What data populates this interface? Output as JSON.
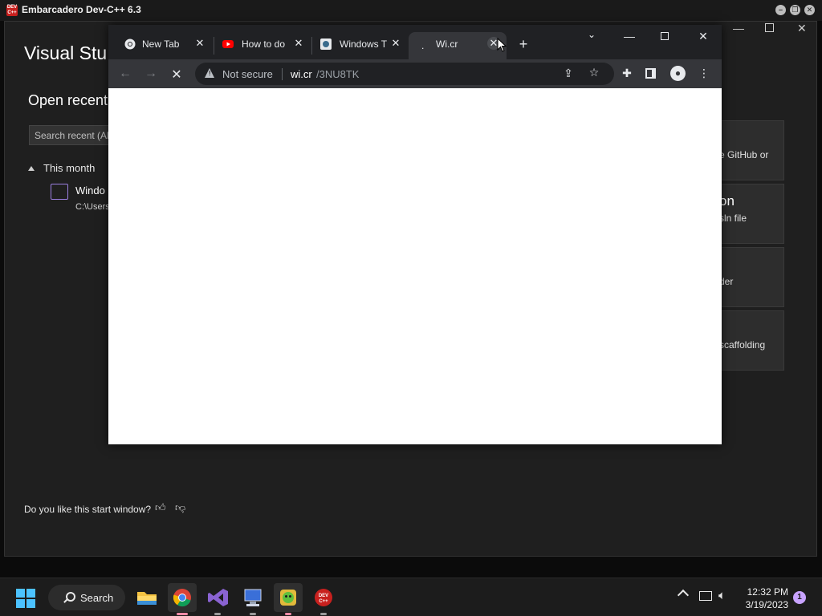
{
  "devcpp": {
    "title": "Embarcadero Dev-C++ 6.3",
    "logo_text": "DEV C++"
  },
  "vs": {
    "title": "Visual Stu",
    "open_recent": "Open recent",
    "search_placeholder": "Search recent (Alt",
    "group_label": "This month",
    "recent_item_name": "Windo",
    "recent_item_path": "C:\\Users",
    "cards": [
      {
        "line1": "e GitHub or"
      },
      {
        "big": "on",
        "line1": "sln file"
      },
      {
        "line1": "der"
      },
      {
        "line1": "scaffolding"
      }
    ],
    "feedback": "Do you like this start window?"
  },
  "chrome": {
    "tabs": [
      {
        "label": "New Tab",
        "icon": "chrome-icon"
      },
      {
        "label": "How to do",
        "icon": "youtube-icon"
      },
      {
        "label": "Windows T",
        "icon": "windows-site-icon"
      },
      {
        "label": "Wi.cr",
        "icon": "loading-icon",
        "active": true
      }
    ],
    "new_tab_symbol": "+",
    "address": {
      "security_label": "Not secure",
      "host": "wi.cr",
      "path": "/3NU8TK"
    }
  },
  "taskbar": {
    "search_label": "Search",
    "time": "12:32 PM",
    "date": "3/19/2023",
    "notification_count": "1"
  },
  "colors": {
    "accent_blue": "#4cc2ff",
    "chrome_frame": "#202124",
    "chrome_toolbar": "#35363a",
    "devcpp_red": "#c8201e",
    "vs_purple": "#9b7fe0"
  }
}
